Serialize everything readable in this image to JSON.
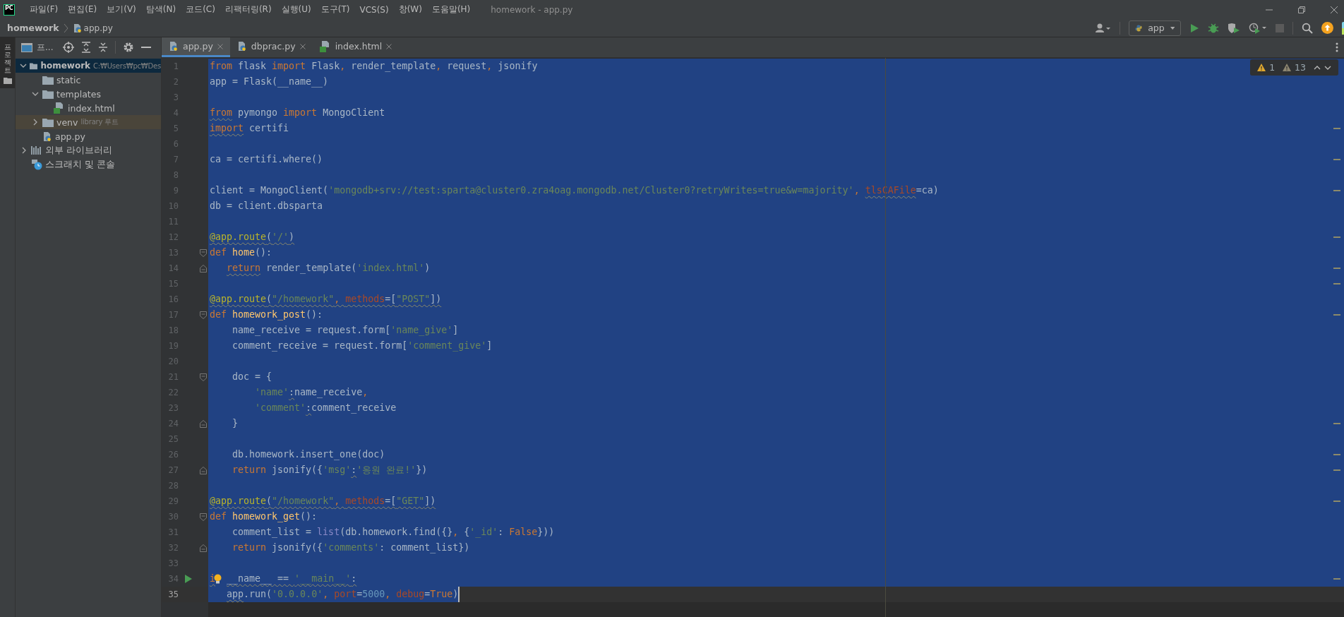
{
  "title_bar": {
    "logo": "PC",
    "menu": [
      "파일(F)",
      "편집(E)",
      "보기(V)",
      "탐색(N)",
      "코드(C)",
      "리팩터링(R)",
      "실행(U)",
      "도구(T)",
      "VCS(S)",
      "창(W)",
      "도움말(H)"
    ],
    "title": "homework - app.py"
  },
  "nav_bar": {
    "breadcrumb": [
      "homework",
      "app.py"
    ],
    "run_config": "app"
  },
  "tool_stripe": {
    "label": "프로젝트",
    "selected": true
  },
  "project_panel": {
    "title": "프...",
    "tree": [
      {
        "label": "homework",
        "hint": "C:₩Users₩pc₩Des",
        "kind": "project",
        "expanded": true,
        "selected": true,
        "excluded": false,
        "children": [
          {
            "label": "static",
            "kind": "folder",
            "selected": false,
            "excluded": false
          },
          {
            "label": "templates",
            "kind": "folder",
            "expanded": true,
            "selected": false,
            "excluded": false,
            "children": [
              {
                "label": "index.html",
                "kind": "html",
                "selected": false,
                "excluded": false
              }
            ]
          },
          {
            "label": "venv",
            "hint": "library 루트",
            "kind": "folder",
            "expanded": false,
            "selected": false,
            "excluded": true
          },
          {
            "label": "app.py",
            "kind": "python",
            "selected": false,
            "excluded": false
          }
        ]
      },
      {
        "label": "외부 라이브러리",
        "kind": "libraries",
        "expanded": false,
        "selected": false,
        "excluded": false
      },
      {
        "label": "스크래치 및 콘솔",
        "kind": "scratches",
        "selected": false,
        "excluded": false
      }
    ]
  },
  "tabs": [
    {
      "label": "app.py",
      "kind": "python",
      "selected": true
    },
    {
      "label": "dbprac.py",
      "kind": "python",
      "selected": false
    },
    {
      "label": "index.html",
      "kind": "html",
      "selected": false
    }
  ],
  "inspections": {
    "warnings": "1",
    "weak_warnings": "13"
  },
  "editor": {
    "lines": [
      {
        "n": "1",
        "selected": true,
        "tokens": [
          {
            "text": "from",
            "kind": "kw"
          },
          {
            "text": " flask ",
            "kind": "tx"
          },
          {
            "text": "import",
            "kind": "kw"
          },
          {
            "text": " Flask",
            "kind": "tx"
          },
          {
            "text": ",",
            "kind": "kw"
          },
          {
            "text": " render_template",
            "kind": "tx"
          },
          {
            "text": ",",
            "kind": "kw"
          },
          {
            "text": " request",
            "kind": "tx"
          },
          {
            "text": ",",
            "kind": "kw"
          },
          {
            "text": " jsonify",
            "kind": "tx"
          }
        ]
      },
      {
        "n": "2",
        "selected": true,
        "tokens": [
          {
            "text": "app = Flask(__name__)",
            "kind": "tx"
          }
        ]
      },
      {
        "n": "3",
        "selected": true
      },
      {
        "n": "4",
        "selected": true,
        "tokens": [
          {
            "text": "from",
            "kind": "kw",
            "wavy": true
          },
          {
            "text": " pymongo ",
            "kind": "tx"
          },
          {
            "text": "import",
            "kind": "kw"
          },
          {
            "text": " MongoClient",
            "kind": "tx"
          }
        ]
      },
      {
        "n": "5",
        "selected": true,
        "marker": true,
        "tokens": [
          {
            "text": "import",
            "kind": "kw",
            "wavy": true
          },
          {
            "text": " certifi",
            "kind": "tx"
          }
        ]
      },
      {
        "n": "6",
        "selected": true
      },
      {
        "n": "7",
        "selected": true,
        "marker": true,
        "tokens": [
          {
            "text": "ca = certifi.where()",
            "kind": "tx"
          }
        ]
      },
      {
        "n": "8",
        "selected": true
      },
      {
        "n": "9",
        "selected": true,
        "marker": true,
        "tokens": [
          {
            "text": "client = MongoClient(",
            "kind": "tx"
          },
          {
            "text": "'mongodb+srv://test:sparta@cluster0.zra4oag.mongodb.net/Cluster0?retryWrites=true&w=majority'",
            "kind": "str"
          },
          {
            "text": ", ",
            "kind": "kw"
          },
          {
            "text": "tlsCAFile",
            "kind": "param",
            "wavy": true
          },
          {
            "text": "=ca)",
            "kind": "tx"
          }
        ]
      },
      {
        "n": "10",
        "selected": true,
        "tokens": [
          {
            "text": "db = client.dbsparta",
            "kind": "tx"
          }
        ]
      },
      {
        "n": "11",
        "selected": true
      },
      {
        "n": "12",
        "selected": true,
        "marker": true,
        "tokens": [
          {
            "text": "@app.route",
            "kind": "deco",
            "wavy": true
          },
          {
            "text": "(",
            "kind": "tx",
            "wavy": true
          },
          {
            "text": "'/'",
            "kind": "str",
            "wavy": true
          },
          {
            "text": ")",
            "kind": "tx",
            "wavy": true
          }
        ]
      },
      {
        "n": "13",
        "selected": true,
        "fold_open": true,
        "tokens": [
          {
            "text": "def ",
            "kind": "kw"
          },
          {
            "text": "home",
            "kind": "fn"
          },
          {
            "text": "():",
            "kind": "tx"
          }
        ]
      },
      {
        "n": "14",
        "selected": true,
        "fold_close": true,
        "marker": true,
        "tokens": [
          {
            "text": "   return",
            "kind": "kw",
            "wavy": true
          },
          {
            "text": " render_template(",
            "kind": "tx"
          },
          {
            "text": "'index.html'",
            "kind": "str"
          },
          {
            "text": ")",
            "kind": "tx"
          }
        ]
      },
      {
        "n": "15",
        "selected": true,
        "marker": true
      },
      {
        "n": "16",
        "selected": true,
        "tokens": [
          {
            "text": "@app.route",
            "kind": "deco",
            "wavy": true
          },
          {
            "text": "(",
            "kind": "tx",
            "wavy": true
          },
          {
            "text": "\"/homework\"",
            "kind": "str",
            "wavy": true
          },
          {
            "text": ", ",
            "kind": "kw",
            "wavy": true
          },
          {
            "text": "methods",
            "kind": "param",
            "wavy": true
          },
          {
            "text": "=[",
            "kind": "tx",
            "wavy": true
          },
          {
            "text": "\"POST\"",
            "kind": "str",
            "wavy": true
          },
          {
            "text": "])",
            "kind": "tx",
            "wavy": true
          }
        ]
      },
      {
        "n": "17",
        "selected": true,
        "fold_open": true,
        "marker": true,
        "tokens": [
          {
            "text": "def ",
            "kind": "kw"
          },
          {
            "text": "homework_post",
            "kind": "fn"
          },
          {
            "text": "():",
            "kind": "tx"
          }
        ]
      },
      {
        "n": "18",
        "selected": true,
        "tokens": [
          {
            "text": "    name_receive = request.form[",
            "kind": "tx"
          },
          {
            "text": "'name_give'",
            "kind": "str"
          },
          {
            "text": "]",
            "kind": "tx"
          }
        ]
      },
      {
        "n": "19",
        "selected": true,
        "tokens": [
          {
            "text": "    comment_receive = request.form[",
            "kind": "tx"
          },
          {
            "text": "'comment_give'",
            "kind": "str"
          },
          {
            "text": "]",
            "kind": "tx"
          }
        ]
      },
      {
        "n": "20",
        "selected": true
      },
      {
        "n": "21",
        "selected": true,
        "fold_open": true,
        "tokens": [
          {
            "text": "    doc = {",
            "kind": "tx"
          }
        ]
      },
      {
        "n": "22",
        "selected": true,
        "tokens": [
          {
            "text": "        'name'",
            "kind": "str"
          },
          {
            "text": ":",
            "kind": "tx",
            "wavy": true
          },
          {
            "text": "name_receive",
            "kind": "tx"
          },
          {
            "text": ",",
            "kind": "kw"
          }
        ]
      },
      {
        "n": "23",
        "selected": true,
        "tokens": [
          {
            "text": "        'comment'",
            "kind": "str"
          },
          {
            "text": ":",
            "kind": "tx",
            "wavy": true
          },
          {
            "text": "comment_receive",
            "kind": "tx"
          }
        ]
      },
      {
        "n": "24",
        "selected": true,
        "fold_close": true,
        "marker": true,
        "tokens": [
          {
            "text": "    }",
            "kind": "tx"
          }
        ]
      },
      {
        "n": "25",
        "selected": true
      },
      {
        "n": "26",
        "selected": true,
        "marker": true,
        "tokens": [
          {
            "text": "    db.homework.insert_one(doc)",
            "kind": "tx"
          }
        ]
      },
      {
        "n": "27",
        "selected": true,
        "fold_close": true,
        "marker": true,
        "tokens": [
          {
            "text": "    return",
            "kind": "kw"
          },
          {
            "text": " jsonify({",
            "kind": "tx"
          },
          {
            "text": "'msg'",
            "kind": "str"
          },
          {
            "text": ":",
            "kind": "tx",
            "wavy": true
          },
          {
            "text": "'응원 완료!'",
            "kind": "str"
          },
          {
            "text": "})",
            "kind": "tx"
          }
        ]
      },
      {
        "n": "28",
        "selected": true
      },
      {
        "n": "29",
        "selected": true,
        "marker": true,
        "tokens": [
          {
            "text": "@app.route",
            "kind": "deco",
            "wavy": true
          },
          {
            "text": "(",
            "kind": "tx",
            "wavy": true
          },
          {
            "text": "\"/homework\"",
            "kind": "str",
            "wavy": true
          },
          {
            "text": ", ",
            "kind": "kw",
            "wavy": true
          },
          {
            "text": "methods",
            "kind": "param",
            "wavy": true
          },
          {
            "text": "=[",
            "kind": "tx",
            "wavy": true
          },
          {
            "text": "\"GET\"",
            "kind": "str",
            "wavy": true
          },
          {
            "text": "])",
            "kind": "tx",
            "wavy": true
          }
        ]
      },
      {
        "n": "30",
        "selected": true,
        "fold_open": true,
        "tokens": [
          {
            "text": "def ",
            "kind": "kw"
          },
          {
            "text": "homework_get",
            "kind": "fn"
          },
          {
            "text": "():",
            "kind": "tx"
          }
        ]
      },
      {
        "n": "31",
        "selected": true,
        "tokens": [
          {
            "text": "    comment_list = ",
            "kind": "tx"
          },
          {
            "text": "list",
            "kind": "builtin"
          },
          {
            "text": "(db.homework.find({}",
            "kind": "tx"
          },
          {
            "text": ", ",
            "kind": "kw"
          },
          {
            "text": "{",
            "kind": "tx"
          },
          {
            "text": "'_id'",
            "kind": "str"
          },
          {
            "text": ": ",
            "kind": "tx"
          },
          {
            "text": "False",
            "kind": "kw"
          },
          {
            "text": "}))",
            "kind": "tx"
          }
        ]
      },
      {
        "n": "32",
        "selected": true,
        "fold_close": true,
        "tokens": [
          {
            "text": "    return",
            "kind": "kw"
          },
          {
            "text": " jsonify({",
            "kind": "tx"
          },
          {
            "text": "'comments'",
            "kind": "str"
          },
          {
            "text": ": comment_list})",
            "kind": "tx"
          }
        ]
      },
      {
        "n": "33",
        "selected": true
      },
      {
        "n": "34",
        "selected": true,
        "run": true,
        "marker": true,
        "tokens": [
          {
            "text": "i",
            "kind": "kw",
            "wavy": true
          },
          {
            "kind": "bulb"
          },
          {
            "text": " __name__ == ",
            "kind": "tx",
            "wavy": true
          },
          {
            "text": "'__main__'",
            "kind": "str",
            "wavy": true
          },
          {
            "text": ":",
            "kind": "tx",
            "wavy": true
          }
        ]
      },
      {
        "n": "35",
        "selected": true,
        "cursor": true,
        "tokens": [
          {
            "text": "   app",
            "kind": "tx",
            "wavy": true
          },
          {
            "text": ".run(",
            "kind": "tx"
          },
          {
            "text": "'0.0.0.0'",
            "kind": "str"
          },
          {
            "text": ", ",
            "kind": "kw"
          },
          {
            "text": "port",
            "kind": "param"
          },
          {
            "text": "=",
            "kind": "tx"
          },
          {
            "text": "5000",
            "kind": "num"
          },
          {
            "text": ", ",
            "kind": "kw"
          },
          {
            "text": "debug",
            "kind": "param"
          },
          {
            "text": "=",
            "kind": "tx"
          },
          {
            "text": "True",
            "kind": "kw"
          },
          {
            "text": ")",
            "kind": "tx"
          }
        ]
      }
    ]
  }
}
